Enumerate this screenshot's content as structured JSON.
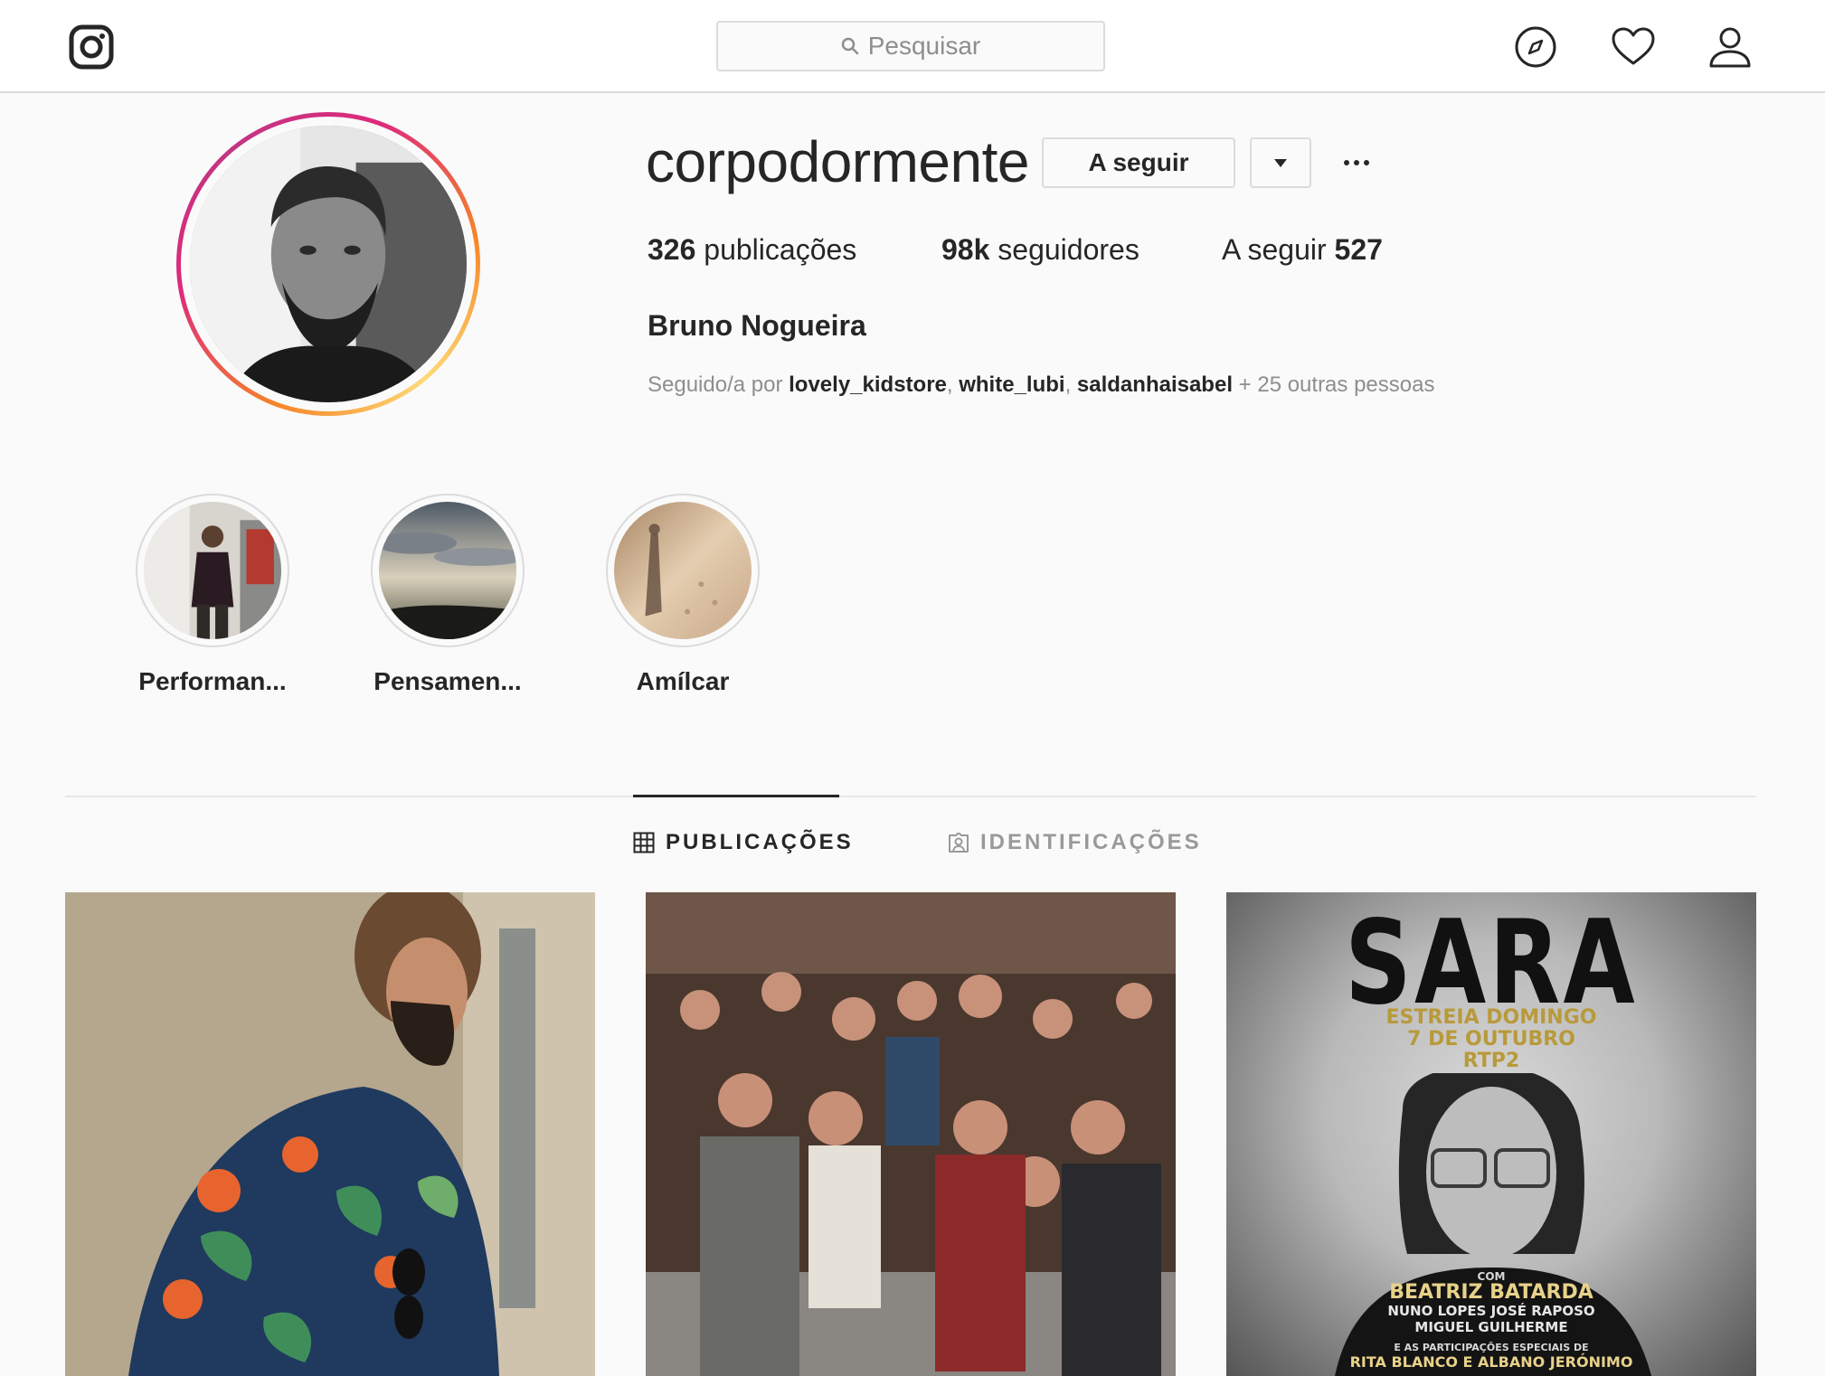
{
  "search": {
    "placeholder": "Pesquisar"
  },
  "profile": {
    "username": "corpodormente",
    "follow_button": "A seguir",
    "stats": {
      "posts_count": "326",
      "posts_label": "publicações",
      "followers_count": "98k",
      "followers_label": "seguidores",
      "following_label": "A seguir",
      "following_count": "527"
    },
    "full_name": "Bruno Nogueira",
    "followed_by": {
      "prefix": "Seguido/a por",
      "users": [
        "lovely_kidstore",
        "white_lubi",
        "saldanhaisabel"
      ],
      "suffix": "+ 25 outras pessoas"
    }
  },
  "highlights": [
    {
      "label": "Performan..."
    },
    {
      "label": "Pensamen..."
    },
    {
      "label": "Amílcar"
    }
  ],
  "tabs": [
    {
      "label": "PUBLICAÇÕES",
      "active": true
    },
    {
      "label": "IDENTIFICAÇÕES",
      "active": false
    }
  ],
  "posts": [
    {
      "id": "post-1"
    },
    {
      "id": "post-2"
    },
    {
      "id": "post-3",
      "title": "SARA",
      "line1": "ESTREIA DOMINGO",
      "line2": "7 DE OUTUBRO",
      "line3": "RTP2",
      "com": "COM",
      "star": "BEATRIZ BATARDA",
      "cast1": "NUNO LOPES JOSÉ RAPOSO",
      "cast2": "MIGUEL GUILHERME",
      "special": "E AS PARTICIPAÇÕES ESPECIAIS DE",
      "special_names": "RITA BLANCO E ALBANO JERÓNIMO"
    }
  ],
  "colors": {
    "accent_ring_start": "#f58529",
    "accent_ring_end": "#c13584",
    "text": "#262626",
    "muted": "#8e8e8e",
    "border": "#dbdbdb"
  }
}
